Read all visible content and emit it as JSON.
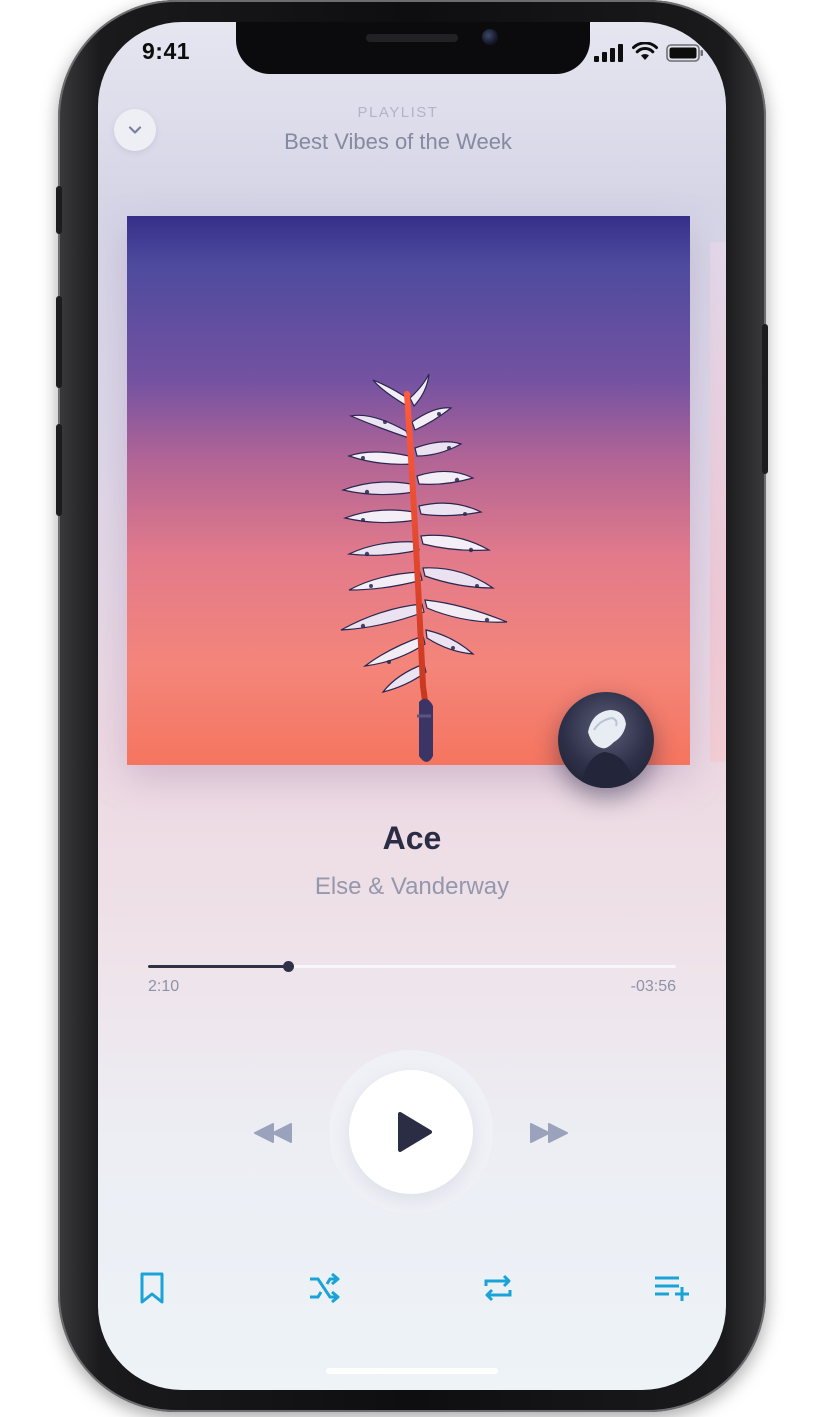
{
  "status_bar": {
    "time": "9:41",
    "icons": [
      "cellular-signal-icon",
      "wifi-icon",
      "battery-icon"
    ]
  },
  "header": {
    "label": "PLAYLIST",
    "title": "Best Vibes of the Week",
    "collapse_icon": "chevron-down-icon"
  },
  "now_playing": {
    "title": "Ace",
    "artist": "Else & Vanderway"
  },
  "progress": {
    "elapsed": "2:10",
    "remaining": "-03:56",
    "fraction": 0.266
  },
  "controls": {
    "rewind_icon": "rewind-icon",
    "play_icon": "play-icon",
    "fast_forward_icon": "fast-forward-icon"
  },
  "toolbar": {
    "items": [
      "bookmark-icon",
      "shuffle-icon",
      "repeat-icon",
      "add-to-queue-icon"
    ]
  },
  "colors": {
    "accent": "#1aa3d6",
    "text_dark": "#2b2d44",
    "text_muted": "#9498ad"
  }
}
